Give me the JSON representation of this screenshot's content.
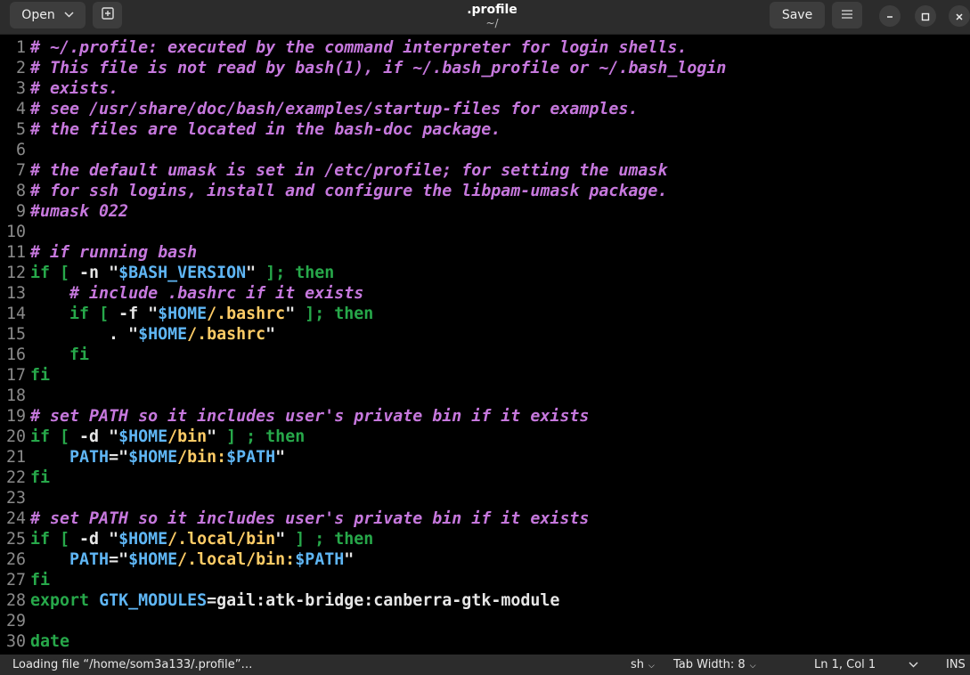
{
  "header": {
    "open_label": "Open",
    "title": ".profile",
    "subtitle": "~/",
    "save_label": "Save"
  },
  "editor": {
    "lines": [
      {
        "n": "1",
        "tokens": [
          {
            "t": "comment",
            "v": "# ~/.profile: executed by the command interpreter for login shells."
          }
        ]
      },
      {
        "n": "2",
        "tokens": [
          {
            "t": "comment",
            "v": "# This file is not read by bash(1), if ~/.bash_profile or ~/.bash_login"
          }
        ]
      },
      {
        "n": "3",
        "tokens": [
          {
            "t": "comment",
            "v": "# exists."
          }
        ]
      },
      {
        "n": "4",
        "tokens": [
          {
            "t": "comment",
            "v": "# see /usr/share/doc/bash/examples/startup-files for examples."
          }
        ]
      },
      {
        "n": "5",
        "tokens": [
          {
            "t": "comment",
            "v": "# the files are located in the bash-doc package."
          }
        ]
      },
      {
        "n": "6",
        "tokens": []
      },
      {
        "n": "7",
        "tokens": [
          {
            "t": "comment",
            "v": "# the default umask is set in /etc/profile; for setting the umask"
          }
        ]
      },
      {
        "n": "8",
        "tokens": [
          {
            "t": "comment",
            "v": "# for ssh logins, install and configure the libpam-umask package."
          }
        ]
      },
      {
        "n": "9",
        "tokens": [
          {
            "t": "comment",
            "v": "#umask 022"
          }
        ]
      },
      {
        "n": "10",
        "tokens": []
      },
      {
        "n": "11",
        "tokens": [
          {
            "t": "comment",
            "v": "# if running bash"
          }
        ]
      },
      {
        "n": "12",
        "tokens": [
          {
            "t": "kw",
            "v": "if"
          },
          {
            "t": "plain",
            "v": " "
          },
          {
            "t": "kw",
            "v": "["
          },
          {
            "t": "plain",
            "v": " -n \""
          },
          {
            "t": "var",
            "v": "$BASH_VERSION"
          },
          {
            "t": "plain",
            "v": "\" "
          },
          {
            "t": "kw",
            "v": "]; then"
          }
        ]
      },
      {
        "n": "13",
        "tokens": [
          {
            "t": "plain",
            "v": "    "
          },
          {
            "t": "comment",
            "v": "# include .bashrc if it exists"
          }
        ]
      },
      {
        "n": "14",
        "tokens": [
          {
            "t": "plain",
            "v": "    "
          },
          {
            "t": "kw",
            "v": "if"
          },
          {
            "t": "plain",
            "v": " "
          },
          {
            "t": "kw",
            "v": "["
          },
          {
            "t": "plain",
            "v": " -f \""
          },
          {
            "t": "var",
            "v": "$HOME"
          },
          {
            "t": "str",
            "v": "/.bashrc"
          },
          {
            "t": "plain",
            "v": "\" "
          },
          {
            "t": "kw",
            "v": "]; then"
          }
        ]
      },
      {
        "n": "15",
        "tokens": [
          {
            "t": "plain",
            "v": "        . \""
          },
          {
            "t": "var",
            "v": "$HOME"
          },
          {
            "t": "str",
            "v": "/.bashrc"
          },
          {
            "t": "plain",
            "v": "\""
          }
        ]
      },
      {
        "n": "16",
        "tokens": [
          {
            "t": "plain",
            "v": "    "
          },
          {
            "t": "kw",
            "v": "fi"
          }
        ]
      },
      {
        "n": "17",
        "tokens": [
          {
            "t": "kw",
            "v": "fi"
          }
        ]
      },
      {
        "n": "18",
        "tokens": []
      },
      {
        "n": "19",
        "tokens": [
          {
            "t": "comment",
            "v": "# set PATH so it includes user's private bin if it exists"
          }
        ]
      },
      {
        "n": "20",
        "tokens": [
          {
            "t": "kw",
            "v": "if"
          },
          {
            "t": "plain",
            "v": " "
          },
          {
            "t": "kw",
            "v": "["
          },
          {
            "t": "plain",
            "v": " -d \""
          },
          {
            "t": "var",
            "v": "$HOME"
          },
          {
            "t": "str",
            "v": "/bin"
          },
          {
            "t": "plain",
            "v": "\" "
          },
          {
            "t": "kw",
            "v": "] ; then"
          }
        ]
      },
      {
        "n": "21",
        "tokens": [
          {
            "t": "plain",
            "v": "    "
          },
          {
            "t": "var",
            "v": "PATH"
          },
          {
            "t": "plain",
            "v": "=\""
          },
          {
            "t": "var",
            "v": "$HOME"
          },
          {
            "t": "str",
            "v": "/bin:"
          },
          {
            "t": "var",
            "v": "$PATH"
          },
          {
            "t": "plain",
            "v": "\""
          }
        ]
      },
      {
        "n": "22",
        "tokens": [
          {
            "t": "kw",
            "v": "fi"
          }
        ]
      },
      {
        "n": "23",
        "tokens": []
      },
      {
        "n": "24",
        "tokens": [
          {
            "t": "comment",
            "v": "# set PATH so it includes user's private bin if it exists"
          }
        ]
      },
      {
        "n": "25",
        "tokens": [
          {
            "t": "kw",
            "v": "if"
          },
          {
            "t": "plain",
            "v": " "
          },
          {
            "t": "kw",
            "v": "["
          },
          {
            "t": "plain",
            "v": " -d \""
          },
          {
            "t": "var",
            "v": "$HOME"
          },
          {
            "t": "str",
            "v": "/.local/bin"
          },
          {
            "t": "plain",
            "v": "\" "
          },
          {
            "t": "kw",
            "v": "] ; then"
          }
        ]
      },
      {
        "n": "26",
        "tokens": [
          {
            "t": "plain",
            "v": "    "
          },
          {
            "t": "var",
            "v": "PATH"
          },
          {
            "t": "plain",
            "v": "=\""
          },
          {
            "t": "var",
            "v": "$HOME"
          },
          {
            "t": "str",
            "v": "/.local/bin:"
          },
          {
            "t": "var",
            "v": "$PATH"
          },
          {
            "t": "plain",
            "v": "\""
          }
        ]
      },
      {
        "n": "27",
        "tokens": [
          {
            "t": "kw",
            "v": "fi"
          }
        ]
      },
      {
        "n": "28",
        "tokens": [
          {
            "t": "kw",
            "v": "export"
          },
          {
            "t": "plain",
            "v": " "
          },
          {
            "t": "var",
            "v": "GTK_MODULES"
          },
          {
            "t": "plain",
            "v": "=gail:atk-bridge:canberra-gtk-module"
          }
        ]
      },
      {
        "n": "29",
        "tokens": []
      },
      {
        "n": "30",
        "tokens": [
          {
            "t": "kw",
            "v": "date"
          }
        ]
      }
    ]
  },
  "status": {
    "message": "Loading file “/home/som3a133/.profile”…",
    "language": "sh",
    "tab_width": "Tab Width: 8",
    "position": "Ln 1, Col 1",
    "mode": "INS"
  },
  "colors": {
    "comment": "#c678dd",
    "keyword": "#27a84a",
    "variable": "#5fb6f5",
    "string": "#ffcc66",
    "plain": "#e6e6e6",
    "line_number": "#8a8a8a",
    "background": "#000000",
    "chrome": "#2c2c2c"
  },
  "icons": {
    "open_dropdown": "chevron-down-icon",
    "new_tab": "new-tab-icon",
    "menu": "hamburger-menu-icon",
    "minimize": "minimize-icon",
    "maximize": "maximize-icon",
    "close": "close-icon"
  }
}
